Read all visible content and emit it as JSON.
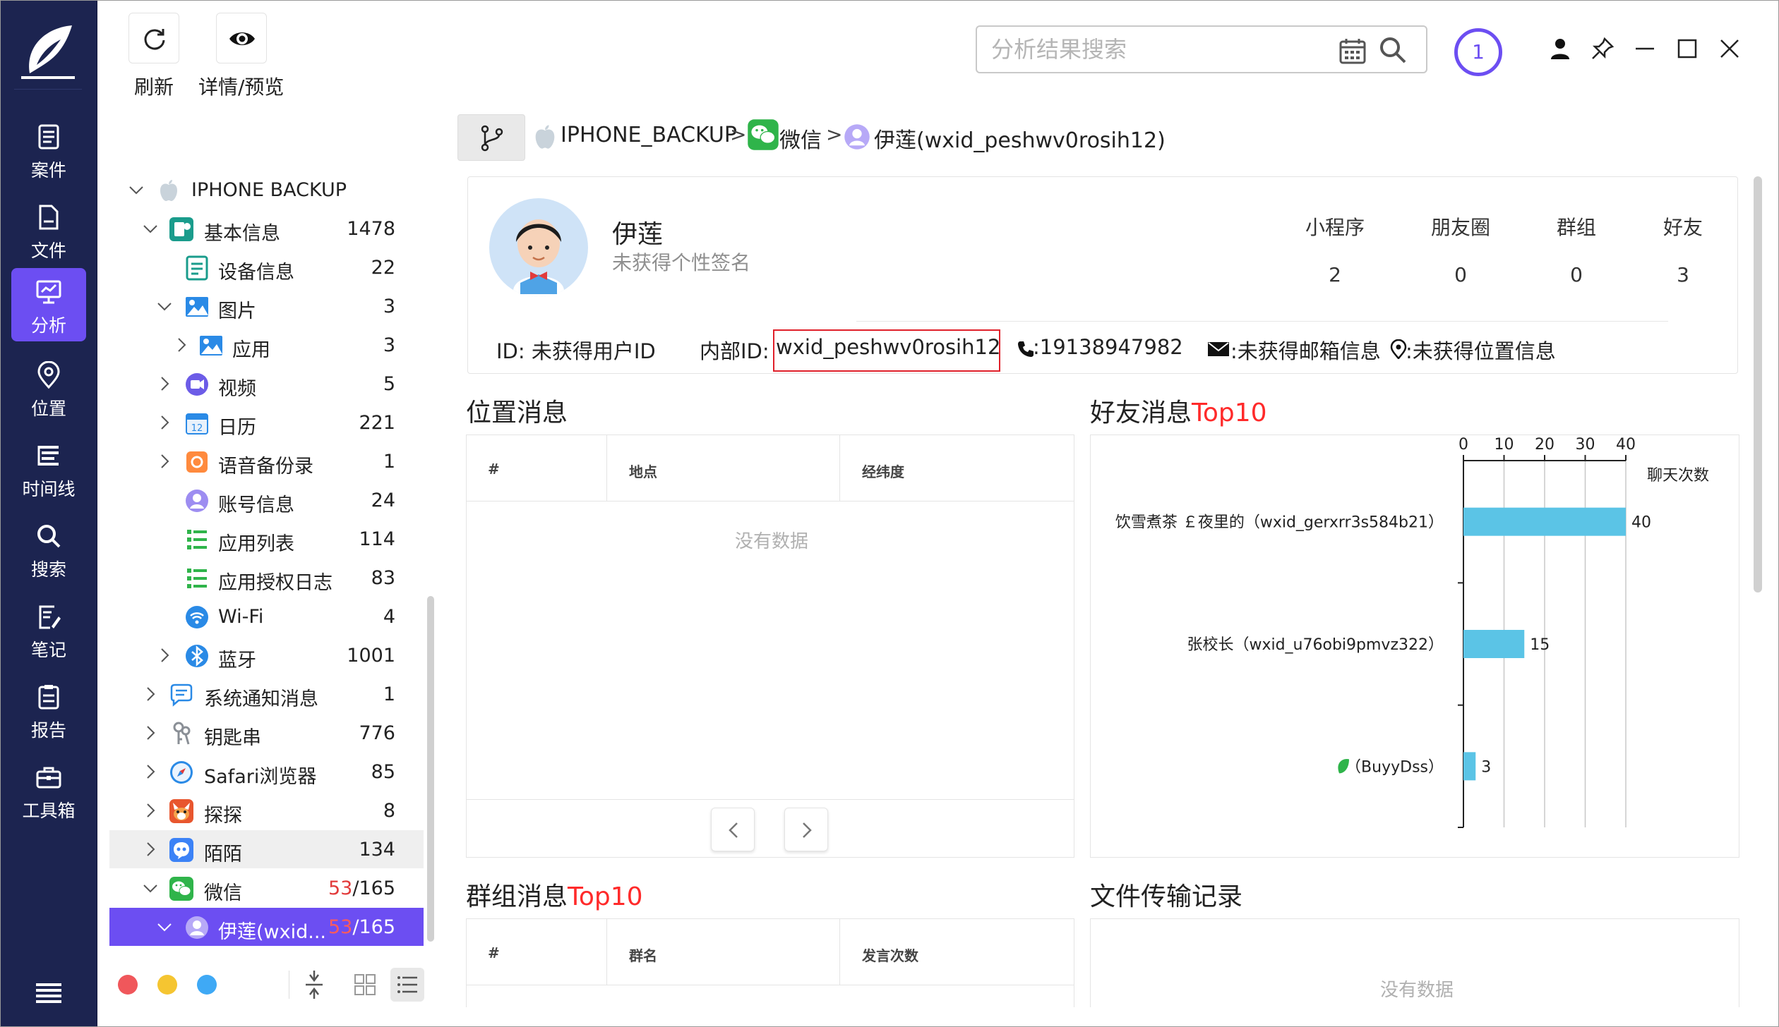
{
  "nav": {
    "items": [
      {
        "label": "案件",
        "icon": "case-icon"
      },
      {
        "label": "文件",
        "icon": "file-icon"
      },
      {
        "label": "分析",
        "icon": "analysis-icon"
      },
      {
        "label": "位置",
        "icon": "location-icon"
      },
      {
        "label": "时间线",
        "icon": "timeline-icon"
      },
      {
        "label": "搜索",
        "icon": "search-icon"
      },
      {
        "label": "笔记",
        "icon": "note-icon"
      },
      {
        "label": "报告",
        "icon": "report-icon"
      },
      {
        "label": "工具箱",
        "icon": "toolbox-icon"
      }
    ],
    "active": "分析"
  },
  "toolbar": {
    "refresh_label": "刷新",
    "details_label": "详情/预览",
    "search_placeholder": "分析结果搜索",
    "notification_count": "1"
  },
  "tree": {
    "items": [
      {
        "label": "IPHONE BACKUP",
        "count": "",
        "icon": "apple-icon"
      },
      {
        "label": "基本信息",
        "count": "1478",
        "icon": "basic-info-icon"
      },
      {
        "label": "设备信息",
        "count": "22",
        "icon": "device-info-icon"
      },
      {
        "label": "图片",
        "count": "3",
        "icon": "image-icon"
      },
      {
        "label": "应用",
        "count": "3",
        "icon": "image-icon"
      },
      {
        "label": "视频",
        "count": "5",
        "icon": "video-icon"
      },
      {
        "label": "日历",
        "count": "221",
        "icon": "calendar-icon"
      },
      {
        "label": "语音备份录",
        "count": "1",
        "icon": "voice-memo-icon"
      },
      {
        "label": "账号信息",
        "count": "24",
        "icon": "account-icon"
      },
      {
        "label": "应用列表",
        "count": "114",
        "icon": "app-list-icon"
      },
      {
        "label": "应用授权日志",
        "count": "83",
        "icon": "app-list-icon"
      },
      {
        "label": "Wi-Fi",
        "count": "4",
        "icon": "wifi-icon"
      },
      {
        "label": "蓝牙",
        "count": "1001",
        "icon": "bluetooth-icon"
      },
      {
        "label": "系统通知消息",
        "count": "1",
        "icon": "notification-icon"
      },
      {
        "label": "钥匙串",
        "count": "776",
        "icon": "keychain-icon"
      },
      {
        "label": "Safari浏览器",
        "count": "85",
        "icon": "safari-icon"
      },
      {
        "label": "探探",
        "count": "8",
        "icon": "tantan-icon"
      },
      {
        "label": "陌陌",
        "count": "134",
        "icon": "momo-icon"
      },
      {
        "label": "微信",
        "count_highlight": "53",
        "count_total": "/165",
        "icon": "wechat-icon"
      },
      {
        "label": "伊莲(wxid...",
        "count_highlight": "53",
        "count_total": "/165",
        "icon": "user-icon"
      }
    ]
  },
  "breadcrumb": {
    "items": [
      "IPHONE_BACKUP",
      "微信",
      "伊莲(wxid_peshwv0rosih12)"
    ],
    "separator": ">"
  },
  "profile": {
    "name": "伊莲",
    "signature": "未获得个性签名",
    "stats": [
      {
        "label": "小程序",
        "value": "2"
      },
      {
        "label": "朋友圈",
        "value": "0"
      },
      {
        "label": "群组",
        "value": "0"
      },
      {
        "label": "好友",
        "value": "3"
      }
    ],
    "id_text": "ID: 未获得用户ID",
    "internal_id_label": "内部ID:",
    "internal_id": "wxid_peshwv0rosih12",
    "phone": ":19138947982",
    "email": ":未获得邮箱信息",
    "location": ":未获得位置信息"
  },
  "location_section": {
    "title": "位置消息",
    "columns": [
      "#",
      "地点",
      "经纬度"
    ],
    "empty_text": "没有数据"
  },
  "friends_section": {
    "title_prefix": "好友消息",
    "title_highlight": "Top10"
  },
  "group_section": {
    "title_prefix": "群组消息",
    "title_highlight": "Top10",
    "columns": [
      "#",
      "群名",
      "发言次数"
    ]
  },
  "file_section": {
    "title": "文件传输记录",
    "empty_text": "没有数据"
  },
  "chart_data": {
    "type": "bar",
    "orientation": "horizontal",
    "categories": [
      "饮雪煮茶 ￡夜里的（wxid_gerxrr3s584b21）",
      "张校长（wxid_u76obi9pmvz322）",
      "（BuyyDss）"
    ],
    "values": [
      40,
      15,
      3
    ],
    "x_ticks": [
      0,
      10,
      20,
      30,
      40
    ],
    "xlim": [
      0,
      40
    ],
    "xlabel": "聊天次数",
    "ylabel": "",
    "title": "",
    "bar_color": "#5bc4e6",
    "x_axis_position": "top",
    "grid": true
  },
  "colors": {
    "rail_bg": "#1c2450",
    "accent": "#6c4ef2",
    "highlight_red": "#ff2a2a",
    "bar": "#5bc4e6"
  }
}
